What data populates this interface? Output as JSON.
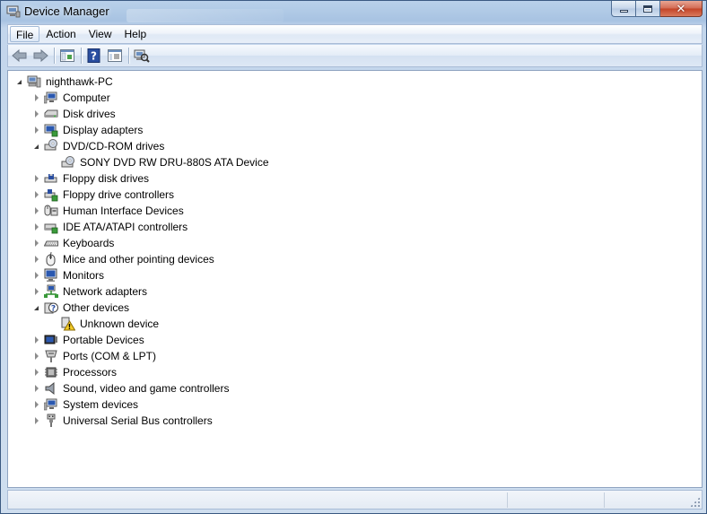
{
  "window": {
    "title": "Device Manager"
  },
  "menu": [
    {
      "label": "File",
      "active": true
    },
    {
      "label": "Action",
      "active": false
    },
    {
      "label": "View",
      "active": false
    },
    {
      "label": "Help",
      "active": false
    }
  ],
  "toolbar": [
    {
      "name": "back-button",
      "icon": "back-arrow-icon"
    },
    {
      "name": "forward-button",
      "icon": "forward-arrow-icon"
    },
    {
      "name": "sep"
    },
    {
      "name": "show-hide-console-tree-button",
      "icon": "console-tree-icon"
    },
    {
      "name": "sep"
    },
    {
      "name": "help-button",
      "icon": "help-icon"
    },
    {
      "name": "properties-button",
      "icon": "properties-icon"
    },
    {
      "name": "sep"
    },
    {
      "name": "scan-hardware-changes-button",
      "icon": "scan-hardware-icon"
    }
  ],
  "tree": {
    "root": {
      "label": "nighthawk-PC",
      "icon": "computer-root-icon",
      "expanded": true
    },
    "categories": [
      {
        "label": "Computer",
        "icon": "computer-icon",
        "expanded": false,
        "children": []
      },
      {
        "label": "Disk drives",
        "icon": "disk-drive-icon",
        "expanded": false,
        "children": []
      },
      {
        "label": "Display adapters",
        "icon": "display-adapter-icon",
        "expanded": false,
        "children": []
      },
      {
        "label": "DVD/CD-ROM drives",
        "icon": "dvd-drive-icon",
        "expanded": true,
        "children": [
          {
            "label": "SONY DVD RW DRU-880S ATA Device",
            "icon": "dvd-device-icon"
          }
        ]
      },
      {
        "label": "Floppy disk drives",
        "icon": "floppy-disk-icon",
        "expanded": false,
        "children": []
      },
      {
        "label": "Floppy drive controllers",
        "icon": "floppy-controller-icon",
        "expanded": false,
        "children": []
      },
      {
        "label": "Human Interface Devices",
        "icon": "hid-icon",
        "expanded": false,
        "children": []
      },
      {
        "label": "IDE ATA/ATAPI controllers",
        "icon": "ide-controller-icon",
        "expanded": false,
        "children": []
      },
      {
        "label": "Keyboards",
        "icon": "keyboard-icon",
        "expanded": false,
        "children": []
      },
      {
        "label": "Mice and other pointing devices",
        "icon": "mouse-icon",
        "expanded": false,
        "children": []
      },
      {
        "label": "Monitors",
        "icon": "monitor-icon",
        "expanded": false,
        "children": []
      },
      {
        "label": "Network adapters",
        "icon": "network-adapter-icon",
        "expanded": false,
        "children": []
      },
      {
        "label": "Other devices",
        "icon": "other-devices-icon",
        "expanded": true,
        "children": [
          {
            "label": "Unknown device",
            "icon": "unknown-device-warning-icon"
          }
        ]
      },
      {
        "label": "Portable Devices",
        "icon": "portable-device-icon",
        "expanded": false,
        "children": []
      },
      {
        "label": "Ports (COM & LPT)",
        "icon": "port-icon",
        "expanded": false,
        "children": []
      },
      {
        "label": "Processors",
        "icon": "processor-icon",
        "expanded": false,
        "children": []
      },
      {
        "label": "Sound, video and game controllers",
        "icon": "sound-icon",
        "expanded": false,
        "children": []
      },
      {
        "label": "System devices",
        "icon": "system-device-icon",
        "expanded": false,
        "children": []
      },
      {
        "label": "Universal Serial Bus controllers",
        "icon": "usb-icon",
        "expanded": false,
        "children": []
      }
    ]
  },
  "colors": {
    "titlebar": "#b9d1ea",
    "close_button": "#c34327",
    "content_bg": "#ffffff"
  }
}
